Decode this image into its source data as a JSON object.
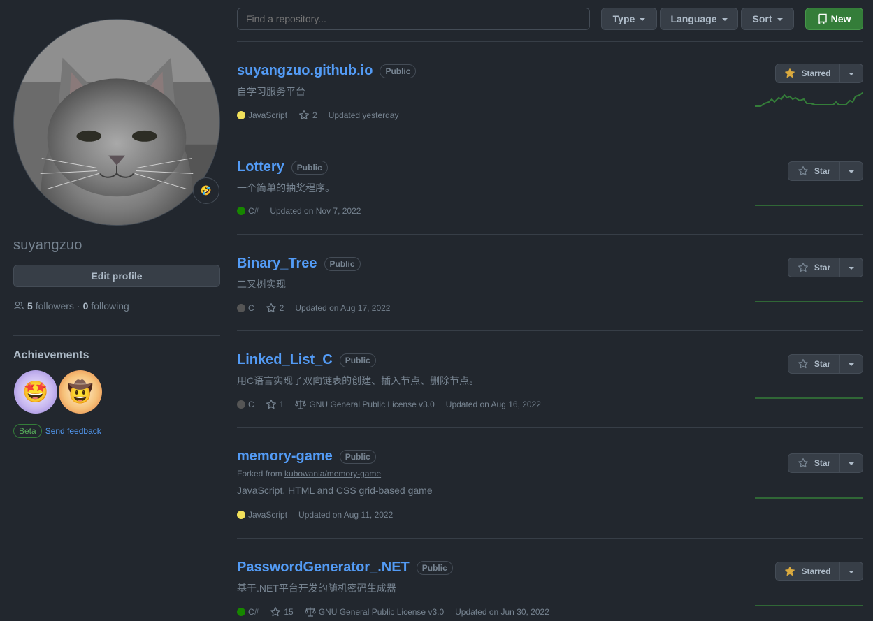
{
  "profile": {
    "username": "suyangzuo",
    "edit_label": "Edit profile",
    "followers_count": "5",
    "followers_label": "followers",
    "separator": "·",
    "following_count": "0",
    "following_label": "following",
    "achievements_title": "Achievements",
    "beta_label": "Beta",
    "feedback_label": "Send feedback",
    "status_emoji": "🤣",
    "achievement_badges": [
      "🤩",
      "🤠"
    ]
  },
  "filters": {
    "search_placeholder": "Find a repository...",
    "type_label": "Type",
    "language_label": "Language",
    "sort_label": "Sort",
    "new_label": "New"
  },
  "colors": {
    "accent_link": "#539bf5",
    "new_button": "#347d39",
    "star_filled": "#daaa3f",
    "sparkline": "#347d39"
  },
  "repos": [
    {
      "name": "suyangzuo.github.io",
      "visibility": "Public",
      "description": "自学习服务平台",
      "language": "JavaScript",
      "language_color": "#f1e05a",
      "stars": "2",
      "license": "",
      "updated": "Updated yesterday",
      "star_label": "Starred",
      "starred": true
    },
    {
      "name": "Lottery",
      "visibility": "Public",
      "description": "一个简单的抽奖程序。",
      "language": "C#",
      "language_color": "#178600",
      "stars": "",
      "license": "",
      "updated": "Updated on Nov 7, 2022",
      "star_label": "Star",
      "starred": false
    },
    {
      "name": "Binary_Tree",
      "visibility": "Public",
      "description": "二叉树实现",
      "language": "C",
      "language_color": "#555555",
      "stars": "2",
      "license": "",
      "updated": "Updated on Aug 17, 2022",
      "star_label": "Star",
      "starred": false
    },
    {
      "name": "Linked_List_C",
      "visibility": "Public",
      "description": "用C语言实现了双向链表的创建、插入节点、删除节点。",
      "language": "C",
      "language_color": "#555555",
      "stars": "1",
      "license": "GNU General Public License v3.0",
      "updated": "Updated on Aug 16, 2022",
      "star_label": "Star",
      "starred": false
    },
    {
      "name": "memory-game",
      "visibility": "Public",
      "forked_from_prefix": "Forked from",
      "forked_from": "kubowania/memory-game",
      "description": "JavaScript, HTML and CSS grid-based game",
      "language": "JavaScript",
      "language_color": "#f1e05a",
      "stars": "",
      "license": "",
      "updated": "Updated on Aug 11, 2022",
      "star_label": "Star",
      "starred": false
    },
    {
      "name": "PasswordGenerator_.NET",
      "visibility": "Public",
      "description": "基于.NET平台开发的随机密码生成器",
      "language": "C#",
      "language_color": "#178600",
      "stars": "15",
      "license": "GNU General Public License v3.0",
      "updated": "Updated on Jun 30, 2022",
      "star_label": "Starred",
      "starred": true
    }
  ]
}
